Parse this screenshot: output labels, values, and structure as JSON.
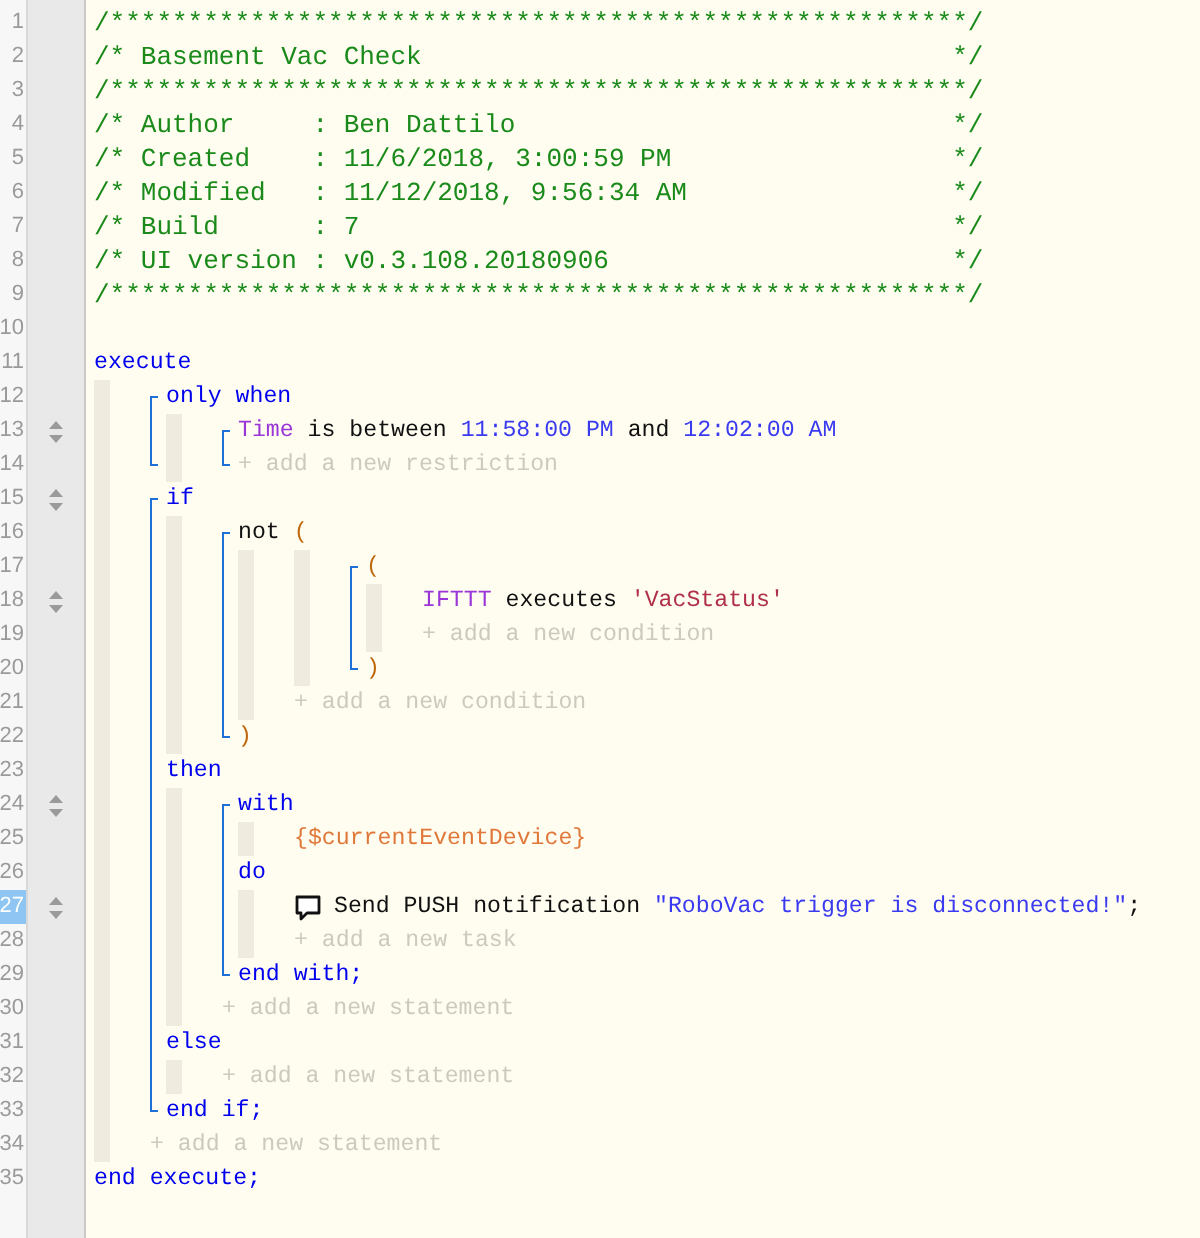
{
  "editor": {
    "rows": [
      {
        "line": "1",
        "kind": "comment",
        "selected": false,
        "handle": false,
        "tokens": [
          {
            "kind": "comment",
            "text": "/*******************************************************/"
          }
        ]
      },
      {
        "line": "2",
        "kind": "comment",
        "selected": false,
        "handle": false,
        "tokens": [
          {
            "kind": "comment",
            "text": "/* Basement Vac Check"
          },
          {
            "kind": "comment_end",
            "text": "*/"
          }
        ]
      },
      {
        "line": "3",
        "kind": "comment",
        "selected": false,
        "handle": false,
        "tokens": [
          {
            "kind": "comment",
            "text": "/*******************************************************/"
          }
        ]
      },
      {
        "line": "4",
        "kind": "comment",
        "selected": false,
        "handle": false,
        "tokens": [
          {
            "kind": "comment",
            "text": "/* Author     : Ben Dattilo"
          },
          {
            "kind": "comment_end",
            "text": "*/"
          }
        ]
      },
      {
        "line": "5",
        "kind": "comment",
        "selected": false,
        "handle": false,
        "tokens": [
          {
            "kind": "comment",
            "text": "/* Created    : 11/6/2018, 3:00:59 PM"
          },
          {
            "kind": "comment_end",
            "text": "*/"
          }
        ]
      },
      {
        "line": "6",
        "kind": "comment",
        "selected": false,
        "handle": false,
        "tokens": [
          {
            "kind": "comment",
            "text": "/* Modified   : 11/12/2018, 9:56:34 AM"
          },
          {
            "kind": "comment_end",
            "text": "*/"
          }
        ]
      },
      {
        "line": "7",
        "kind": "comment",
        "selected": false,
        "handle": false,
        "tokens": [
          {
            "kind": "comment",
            "text": "/* Build      : 7"
          },
          {
            "kind": "comment_end",
            "text": "*/"
          }
        ]
      },
      {
        "line": "8",
        "kind": "comment",
        "selected": false,
        "handle": false,
        "tokens": [
          {
            "kind": "comment",
            "text": "/* UI version : v0.3.108.20180906"
          },
          {
            "kind": "comment_end",
            "text": "*/"
          }
        ]
      },
      {
        "line": "9",
        "kind": "comment",
        "selected": false,
        "handle": false,
        "tokens": [
          {
            "kind": "comment",
            "text": "/*******************************************************/"
          }
        ]
      },
      {
        "line": "10",
        "kind": "blank",
        "selected": false,
        "handle": false
      }
    ],
    "program": {
      "kind": "block",
      "bracketed": false,
      "sections": [
        {
          "header": {
            "line": "11",
            "kind": "row",
            "selected": false,
            "handle": false,
            "tokens": [
              {
                "kind": "keyword",
                "text": "execute"
              }
            ]
          },
          "children": [
            {
              "kind": "block",
              "bracketed": true,
              "sections": [
                {
                  "header": {
                    "line": "12",
                    "kind": "row",
                    "selected": false,
                    "handle": false,
                    "tokens": [
                      {
                        "kind": "keyword",
                        "text": "only when"
                      }
                    ]
                  },
                  "children": [
                    {
                      "kind": "list",
                      "items": [
                        {
                          "line": "13",
                          "kind": "row",
                          "selected": false,
                          "handle": true,
                          "tokens": [
                            {
                              "kind": "subject",
                              "text": "Time"
                            },
                            {
                              "kind": "plain",
                              "text": "is between"
                            },
                            {
                              "kind": "value",
                              "text": "11:58:00 PM"
                            },
                            {
                              "kind": "plain",
                              "text": "and"
                            },
                            {
                              "kind": "value",
                              "text": "12:02:00 AM"
                            }
                          ]
                        },
                        {
                          "line": "14",
                          "kind": "add",
                          "selected": false,
                          "handle": false,
                          "text": "+ add a new restriction"
                        }
                      ]
                    }
                  ]
                }
              ]
            },
            {
              "kind": "block",
              "bracketed": true,
              "sections": [
                {
                  "header": {
                    "line": "15",
                    "kind": "row",
                    "selected": false,
                    "handle": true,
                    "tokens": [
                      {
                        "kind": "keyword",
                        "text": "if"
                      }
                    ]
                  },
                  "children": [
                    {
                      "kind": "block",
                      "bracketed": true,
                      "sections": [
                        {
                          "header": {
                            "line": "16",
                            "kind": "row",
                            "selected": false,
                            "handle": false,
                            "tokens": [
                              {
                                "kind": "plain",
                                "text": "not"
                              },
                              {
                                "kind": "paren",
                                "text": "("
                              }
                            ]
                          },
                          "children": [
                            {
                              "kind": "group",
                              "children": [
                                {
                                  "kind": "block",
                                  "bracketed": true,
                                  "sections": [
                                    {
                                      "header": {
                                        "line": "17",
                                        "kind": "row",
                                        "selected": false,
                                        "handle": false,
                                        "tokens": [
                                          {
                                            "kind": "paren",
                                            "text": "("
                                          }
                                        ]
                                      },
                                      "children": [
                                        {
                                          "line": "18",
                                          "kind": "row",
                                          "selected": false,
                                          "handle": true,
                                          "tokens": [
                                            {
                                              "kind": "subject",
                                              "text": "IFTTT"
                                            },
                                            {
                                              "kind": "plain",
                                              "text": "executes"
                                            },
                                            {
                                              "kind": "string",
                                              "text": "'VacStatus'"
                                            }
                                          ]
                                        },
                                        {
                                          "line": "19",
                                          "kind": "add",
                                          "selected": false,
                                          "handle": false,
                                          "text": "+ add a new condition"
                                        }
                                      ]
                                    }
                                  ],
                                  "closing": {
                                    "line": "20",
                                    "kind": "row",
                                    "selected": false,
                                    "handle": false,
                                    "tokens": [
                                      {
                                        "kind": "paren",
                                        "text": ")"
                                      }
                                    ]
                                  }
                                }
                              ]
                            },
                            {
                              "line": "21",
                              "kind": "add",
                              "selected": false,
                              "handle": false,
                              "text": "+ add a new condition"
                            }
                          ]
                        }
                      ],
                      "closing": {
                        "line": "22",
                        "kind": "row",
                        "selected": false,
                        "handle": false,
                        "tokens": [
                          {
                            "kind": "paren",
                            "text": ")"
                          }
                        ]
                      }
                    }
                  ]
                },
                {
                  "header": {
                    "line": "23",
                    "kind": "row",
                    "selected": false,
                    "handle": false,
                    "tokens": [
                      {
                        "kind": "keyword",
                        "text": "then"
                      }
                    ]
                  },
                  "children": [
                    {
                      "kind": "block",
                      "bracketed": true,
                      "sections": [
                        {
                          "header": {
                            "line": "24",
                            "kind": "row",
                            "selected": false,
                            "handle": true,
                            "tokens": [
                              {
                                "kind": "keyword",
                                "text": "with"
                              }
                            ]
                          },
                          "children": [
                            {
                              "line": "25",
                              "kind": "row",
                              "selected": false,
                              "handle": false,
                              "tokens": [
                                {
                                  "kind": "variable",
                                  "text": "{$currentEventDevice}"
                                }
                              ]
                            }
                          ]
                        },
                        {
                          "header": {
                            "line": "26",
                            "kind": "row",
                            "selected": false,
                            "handle": false,
                            "tokens": [
                              {
                                "kind": "keyword",
                                "text": "do"
                              }
                            ]
                          },
                          "children": [
                            {
                              "line": "27",
                              "kind": "task",
                              "selected": true,
                              "handle": true,
                              "tokens": [
                                {
                                  "kind": "plain",
                                  "text": "Send PUSH notification"
                                },
                                {
                                  "kind": "value",
                                  "text": "\"RoboVac trigger is disconnected!\""
                                },
                                {
                                  "kind": "punct",
                                  "text": ";"
                                }
                              ]
                            },
                            {
                              "line": "28",
                              "kind": "add",
                              "selected": false,
                              "handle": false,
                              "text": "+ add a new task"
                            }
                          ]
                        }
                      ],
                      "closing": {
                        "line": "29",
                        "kind": "row",
                        "selected": false,
                        "handle": false,
                        "tokens": [
                          {
                            "kind": "keyword",
                            "text": "end with;"
                          }
                        ]
                      }
                    },
                    {
                      "line": "30",
                      "kind": "add",
                      "selected": false,
                      "handle": false,
                      "text": "+ add a new statement"
                    }
                  ]
                },
                {
                  "header": {
                    "line": "31",
                    "kind": "row",
                    "selected": false,
                    "handle": false,
                    "tokens": [
                      {
                        "kind": "keyword",
                        "text": "else"
                      }
                    ]
                  },
                  "children": [
                    {
                      "line": "32",
                      "kind": "add",
                      "selected": false,
                      "handle": false,
                      "text": "+ add a new statement"
                    }
                  ]
                }
              ],
              "closing": {
                "line": "33",
                "kind": "row",
                "selected": false,
                "handle": false,
                "tokens": [
                  {
                    "kind": "keyword",
                    "text": "end if;"
                  }
                ]
              }
            },
            {
              "line": "34",
              "kind": "add",
              "selected": false,
              "handle": false,
              "text": "+ add a new statement"
            }
          ]
        }
      ],
      "closing": {
        "line": "35",
        "kind": "row",
        "selected": false,
        "handle": false,
        "tokens": [
          {
            "kind": "keyword",
            "text": "end execute;"
          }
        ]
      }
    }
  }
}
